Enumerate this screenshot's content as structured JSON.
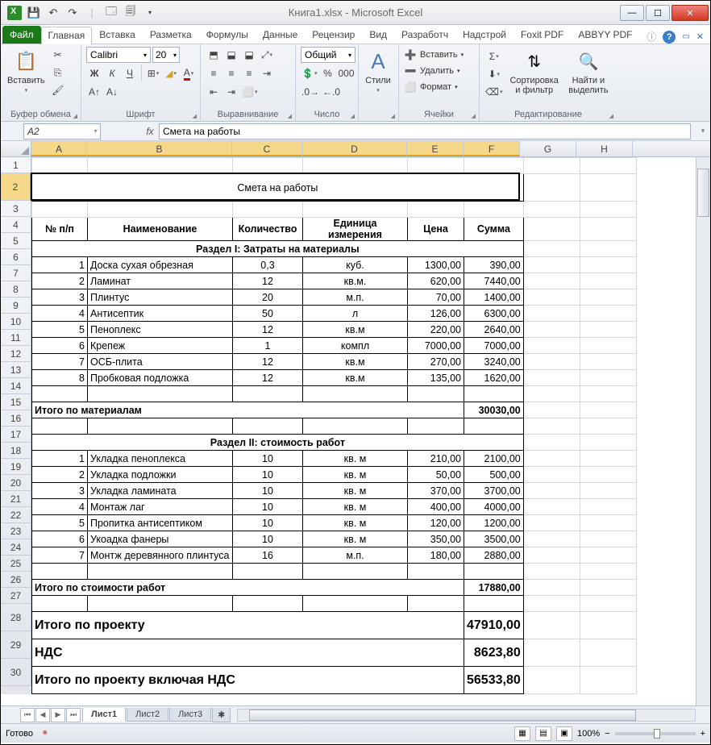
{
  "window": {
    "title": "Книга1.xlsx  -  Microsoft Excel"
  },
  "tabs": {
    "file": "Файл",
    "items": [
      "Главная",
      "Вставка",
      "Разметка",
      "Формулы",
      "Данные",
      "Рецензир",
      "Вид",
      "Разработч",
      "Надстрой",
      "Foxit PDF",
      "ABBYY PDF"
    ],
    "active": 0
  },
  "ribbon": {
    "clipboard": {
      "paste": "Вставить",
      "label": "Буфер обмена"
    },
    "font": {
      "name": "Calibri",
      "size": "20",
      "label": "Шрифт"
    },
    "align": {
      "label": "Выравнивание"
    },
    "number": {
      "format": "Общий",
      "label": "Число"
    },
    "styles": {
      "btn": "Стили",
      "label": ""
    },
    "cells": {
      "insert": "Вставить",
      "delete": "Удалить",
      "format": "Формат",
      "label": "Ячейки"
    },
    "editing": {
      "sort": "Сортировка и фильтр",
      "find": "Найти и выделить",
      "label": "Редактирование"
    }
  },
  "namebox": "A2",
  "formula": "Смета на работы",
  "cols": [
    "A",
    "B",
    "C",
    "D",
    "E",
    "F",
    "G",
    "H"
  ],
  "sheet": {
    "title": "Смета на работы",
    "headers": [
      "№ п/п",
      "Наименование",
      "Количество",
      "Единица измерения",
      "Цена",
      "Сумма"
    ],
    "section1": "Раздел I: Затраты на материалы",
    "rows1": [
      {
        "n": "1",
        "name": "Доска сухая обрезная",
        "qty": "0,3",
        "unit": "куб.",
        "price": "1300,00",
        "sum": "390,00"
      },
      {
        "n": "2",
        "name": "Ламинат",
        "qty": "12",
        "unit": "кв.м.",
        "price": "620,00",
        "sum": "7440,00"
      },
      {
        "n": "3",
        "name": "Плинтус",
        "qty": "20",
        "unit": "м.п.",
        "price": "70,00",
        "sum": "1400,00"
      },
      {
        "n": "4",
        "name": "Антисептик",
        "qty": "50",
        "unit": "л",
        "price": "126,00",
        "sum": "6300,00"
      },
      {
        "n": "5",
        "name": "Пеноплекс",
        "qty": "12",
        "unit": "кв.м",
        "price": "220,00",
        "sum": "2640,00"
      },
      {
        "n": "6",
        "name": "Крепеж",
        "qty": "1",
        "unit": "компл",
        "price": "7000,00",
        "sum": "7000,00"
      },
      {
        "n": "7",
        "name": "ОСБ-плита",
        "qty": "12",
        "unit": "кв.м",
        "price": "270,00",
        "sum": "3240,00"
      },
      {
        "n": "8",
        "name": "Пробковая подложка",
        "qty": "12",
        "unit": "кв.м",
        "price": "135,00",
        "sum": "1620,00"
      }
    ],
    "subtotal1_label": "Итого по материалам",
    "subtotal1": "30030,00",
    "section2": "Раздел II: стоимость работ",
    "rows2": [
      {
        "n": "1",
        "name": "Укладка пеноплекса",
        "qty": "10",
        "unit": "кв. м",
        "price": "210,00",
        "sum": "2100,00"
      },
      {
        "n": "2",
        "name": "Укладка подложки",
        "qty": "10",
        "unit": "кв. м",
        "price": "50,00",
        "sum": "500,00"
      },
      {
        "n": "3",
        "name": "Укладка  ламината",
        "qty": "10",
        "unit": "кв. м",
        "price": "370,00",
        "sum": "3700,00"
      },
      {
        "n": "4",
        "name": "Монтаж лаг",
        "qty": "10",
        "unit": "кв. м",
        "price": "400,00",
        "sum": "4000,00"
      },
      {
        "n": "5",
        "name": "Пропитка антисептиком",
        "qty": "10",
        "unit": "кв. м",
        "price": "120,00",
        "sum": "1200,00"
      },
      {
        "n": "6",
        "name": "Укоадка фанеры",
        "qty": "10",
        "unit": "кв. м",
        "price": "350,00",
        "sum": "3500,00"
      },
      {
        "n": "7",
        "name": "Монтж деревянного плинтуса",
        "qty": "16",
        "unit": "м.п.",
        "price": "180,00",
        "sum": "2880,00"
      }
    ],
    "subtotal2_label": "Итого по стоимости работ",
    "subtotal2": "17880,00",
    "total_label": "Итого по проекту",
    "total": "47910,00",
    "vat_label": "НДС",
    "vat": "8623,80",
    "grand_label": "Итого по проекту включая НДС",
    "grand": "56533,80"
  },
  "sheets": [
    "Лист1",
    "Лист2",
    "Лист3"
  ],
  "status": {
    "ready": "Готово",
    "zoom": "100%"
  }
}
